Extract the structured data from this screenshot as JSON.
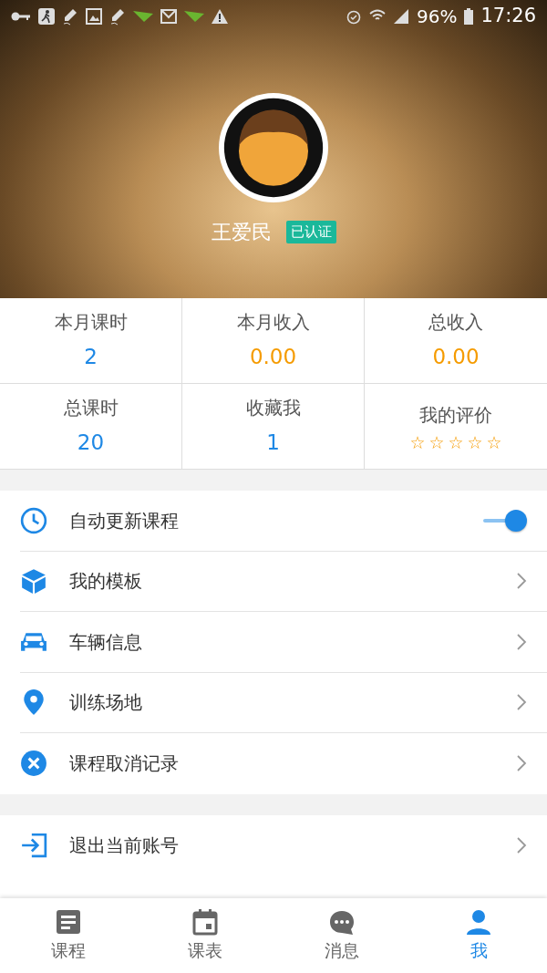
{
  "status_bar": {
    "battery": "96%",
    "time": "17:26"
  },
  "profile": {
    "name": "王爱民",
    "badge": "已认证"
  },
  "stats": [
    {
      "label": "本月课时",
      "value": "2",
      "kind": "count"
    },
    {
      "label": "本月收入",
      "value": "0.00",
      "kind": "money"
    },
    {
      "label": "总收入",
      "value": "0.00",
      "kind": "money"
    },
    {
      "label": "总课时",
      "value": "20",
      "kind": "count"
    },
    {
      "label": "收藏我",
      "value": "1",
      "kind": "count"
    },
    {
      "label": "我的评价",
      "stars": 0,
      "kind": "rating"
    }
  ],
  "menu_groups": [
    [
      {
        "label": "自动更新课程",
        "kind": "toggle",
        "on": true
      },
      {
        "label": "我的模板",
        "kind": "link"
      },
      {
        "label": "车辆信息",
        "kind": "link"
      },
      {
        "label": "训练场地",
        "kind": "link"
      },
      {
        "label": "课程取消记录",
        "kind": "link"
      }
    ],
    [
      {
        "label": "退出当前账号",
        "kind": "link"
      }
    ]
  ],
  "tabs": [
    {
      "label": "课程",
      "selected": false
    },
    {
      "label": "课表",
      "selected": false
    },
    {
      "label": "消息",
      "selected": false
    },
    {
      "label": "我",
      "selected": true
    }
  ]
}
